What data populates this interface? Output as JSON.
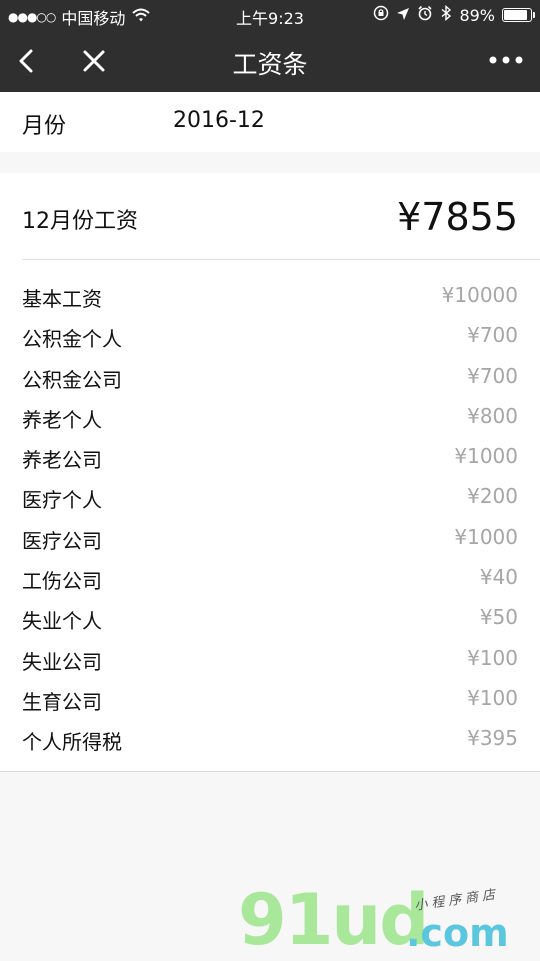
{
  "status_bar": {
    "signal": "●●●○○",
    "carrier": "中国移动",
    "time": "上午9:23",
    "battery": "89%",
    "battery_level": 0.89
  },
  "nav": {
    "title": "工资条"
  },
  "month": {
    "label": "月份",
    "value": "2016-12"
  },
  "salary": {
    "title": "12月份工资",
    "total": "¥7855",
    "items": [
      {
        "label": "基本工资",
        "value": "¥10000"
      },
      {
        "label": "公积金个人",
        "value": "¥700"
      },
      {
        "label": "公积金公司",
        "value": "¥700"
      },
      {
        "label": "养老个人",
        "value": "¥800"
      },
      {
        "label": "养老公司",
        "value": "¥1000"
      },
      {
        "label": "医疗个人",
        "value": "¥200"
      },
      {
        "label": "医疗公司",
        "value": "¥1000"
      },
      {
        "label": "工伤公司",
        "value": "¥40"
      },
      {
        "label": "失业个人",
        "value": "¥50"
      },
      {
        "label": "失业公司",
        "value": "¥100"
      },
      {
        "label": "生育公司",
        "value": "¥100"
      },
      {
        "label": "个人所得税",
        "value": "¥395"
      }
    ]
  },
  "watermark": {
    "main": "91ud",
    "suffix": ".com",
    "tag": "小程序商店"
  },
  "colors": {
    "nav_background": "#2f2f2f",
    "page_background": "#f7f7f7",
    "value_gray": "#a6a6a6",
    "watermark_green": "#a9e89a",
    "watermark_blue": "#5bc7de"
  },
  "icons": [
    "wifi-icon",
    "lock-rotation-icon",
    "location-arrow-icon",
    "alarm-icon",
    "bluetooth-icon",
    "battery-icon",
    "back-chevron-icon",
    "close-icon",
    "more-dots-icon"
  ]
}
